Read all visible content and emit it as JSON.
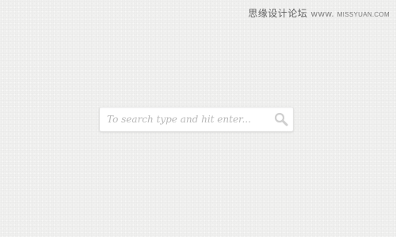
{
  "watermark": {
    "site_name": "思缘设计论坛",
    "separator": "www.",
    "url": "MISSYUAN.COM"
  },
  "search": {
    "placeholder": "To search type and hit enter...",
    "value": "",
    "button_icon": "magnifier-icon"
  },
  "colors": {
    "background": "#f0f0ef",
    "box": "#ffffff",
    "placeholder": "#b9b9b9",
    "icon": "#cfcfcf"
  }
}
